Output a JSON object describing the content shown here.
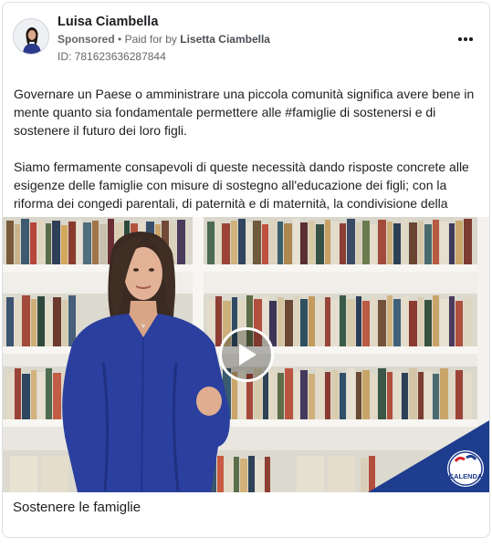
{
  "post": {
    "advertiser_name": "Luisa Ciambella",
    "sponsored_label": "Sponsored",
    "separator": "•",
    "paid_for_prefix": "Paid for by",
    "paid_for_name": "Lisetta Ciambella",
    "ad_id": "ID: 781623636287844",
    "paragraph_1": "Governare un Paese o amministrare una piccola comunità significa avere bene in mente quanto sia fondamentale permettere alle #famiglie di sostenersi e di sostenere il futuro dei loro figli.",
    "paragraph_2": "Siamo fermamente consapevoli di queste necessità dando risposte concrete alle esigenze delle famiglie con misure di sostegno all'educazione dei figli; con la riforma dei congedi parentali, di paternità e di maternità, la condivisione della cur…",
    "media_caption": "Sostenere le famiglie",
    "party_logo_text": "CALENDA"
  },
  "icons": {
    "more": "more-options-icon",
    "play": "play-icon",
    "avatar": "avatar"
  },
  "colors": {
    "party_blue": "#1f3d8f",
    "party_red": "#d8232a",
    "dress_blue": "#2a3f9e"
  }
}
